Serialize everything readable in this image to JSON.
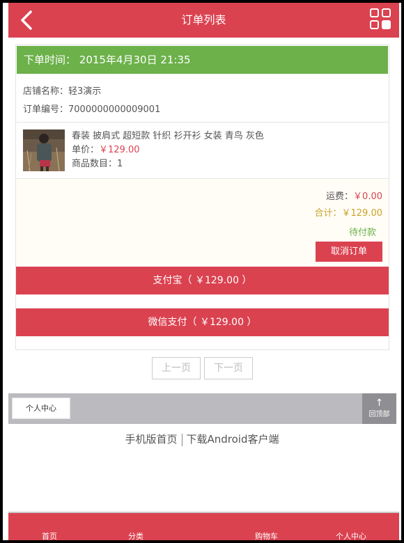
{
  "header": {
    "title": "订单列表",
    "back_icon": "chevron-left-icon",
    "menu_icon": "grid-menu-icon"
  },
  "order": {
    "time_label": "下单时间：",
    "time_value": "2015年4月30日 21:35",
    "store_label": "店铺名称：",
    "store_name": "轻3演示",
    "number_label": "订单编号：",
    "number_value": "7000000000009001",
    "product": {
      "name": "春装 披肩式 超短款 针织 衫开衫 女装 青鸟 灰色",
      "price_label": "单价：",
      "price": "￥129.00",
      "qty_label": "商品数目：",
      "qty": "1"
    },
    "shipping_label": "运费：",
    "shipping": "￥0.00",
    "total_label": "合计：",
    "total": "￥129.00",
    "status": "待付款",
    "cancel_label": "取消订单",
    "alipay_label": "支付宝（ ￥129.00 ）",
    "wechat_label": "微信支付（ ￥129.00 ）"
  },
  "pager": {
    "prev": "上一页",
    "next": "下一页"
  },
  "footer": {
    "user_center": "个人中心",
    "top_label": "回顶部",
    "links": [
      "手机版首页",
      "下载Android客户端"
    ]
  },
  "tabs": [
    "首页",
    "分类",
    "购物车",
    "个人中心"
  ],
  "colors": {
    "accent": "#db4250",
    "order_header": "#6cb14a",
    "status": "#6cb14a",
    "total": "#c9a227"
  }
}
